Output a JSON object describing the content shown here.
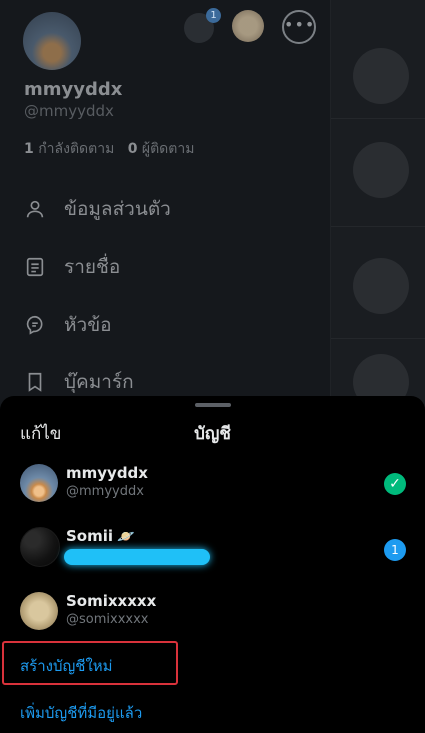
{
  "profile": {
    "name": "mmyyddx",
    "handle": "@mmyyddx",
    "following_count": "1",
    "following_label": "กำลังติดตาม",
    "followers_count": "0",
    "followers_label": "ผู้ติดตาม",
    "badge_count": "1"
  },
  "menu": [
    {
      "label": "ข้อมูลส่วนตัว",
      "icon": "person-icon"
    },
    {
      "label": "รายชื่อ",
      "icon": "list-icon"
    },
    {
      "label": "หัวข้อ",
      "icon": "topics-icon"
    },
    {
      "label": "บุ๊คมาร์ก",
      "icon": "bookmark-icon"
    }
  ],
  "sheet": {
    "edit_label": "แก้ไข",
    "title": "บัญชี",
    "accounts": [
      {
        "name": "mmyyddx",
        "handle": "@mmyyddx",
        "status": "current"
      },
      {
        "name": "Somii",
        "handle": "",
        "status": "notifications",
        "count": "1"
      },
      {
        "name": "Somixxxxx",
        "handle": "@somixxxxx",
        "status": "none"
      }
    ],
    "create_account": "สร้างบัญชีใหม่",
    "add_existing": "เพิ่มบัญชีที่มีอยู่แล้ว"
  },
  "colors": {
    "accent": "#1d9bf0",
    "check": "#00ba7c",
    "highlight_box": "#d9323b"
  }
}
